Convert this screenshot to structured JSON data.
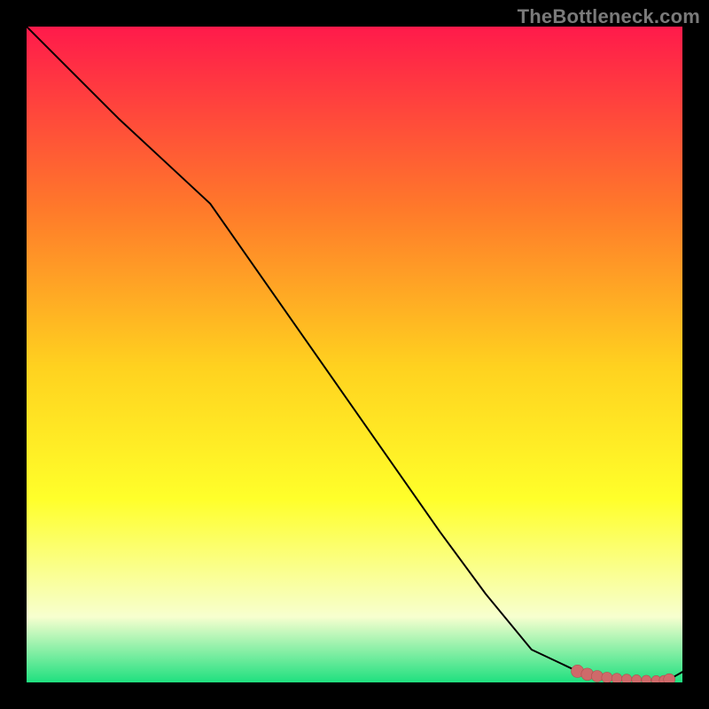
{
  "watermark": "TheBottleneck.com",
  "colors": {
    "background": "#000000",
    "gradient_top": "#ff1a4b",
    "gradient_mid_upper": "#ff7a2a",
    "gradient_mid": "#ffd21f",
    "gradient_mid_lower": "#ffff2a",
    "gradient_low": "#f7ffcf",
    "gradient_bottom": "#1fe07f",
    "line": "#000000",
    "marker_fill": "#cf6a6a",
    "marker_stroke": "#b24f4f"
  },
  "chart_data": {
    "type": "line",
    "title": "",
    "xlabel": "",
    "ylabel": "",
    "xlim": [
      0,
      100
    ],
    "ylim": [
      0,
      100
    ],
    "grid": false,
    "legend": false,
    "series": [
      {
        "name": "curve",
        "x": [
          0,
          7,
          14,
          21,
          28,
          35,
          42,
          49,
          56,
          63,
          70,
          77,
          84,
          88,
          91,
          93,
          95,
          96.5,
          98,
          100
        ],
        "y": [
          100,
          93,
          86,
          79.5,
          73,
          63,
          53,
          43,
          33,
          23,
          13.5,
          5,
          1.7,
          0.9,
          0.55,
          0.42,
          0.35,
          0.32,
          0.45,
          1.6
        ]
      }
    ],
    "markers": {
      "name": "highlight-segment",
      "points": [
        {
          "x": 84.0,
          "y": 1.7,
          "r": 1.2
        },
        {
          "x": 85.5,
          "y": 1.25,
          "r": 1.15
        },
        {
          "x": 87.0,
          "y": 0.95,
          "r": 1.05
        },
        {
          "x": 88.5,
          "y": 0.75,
          "r": 0.95
        },
        {
          "x": 90.0,
          "y": 0.6,
          "r": 0.9
        },
        {
          "x": 91.5,
          "y": 0.5,
          "r": 0.85
        },
        {
          "x": 93.0,
          "y": 0.42,
          "r": 0.8
        },
        {
          "x": 94.5,
          "y": 0.37,
          "r": 0.78
        },
        {
          "x": 96.0,
          "y": 0.33,
          "r": 0.76
        },
        {
          "x": 97.2,
          "y": 0.34,
          "r": 0.8
        },
        {
          "x": 98.0,
          "y": 0.45,
          "r": 1.05
        }
      ]
    }
  }
}
